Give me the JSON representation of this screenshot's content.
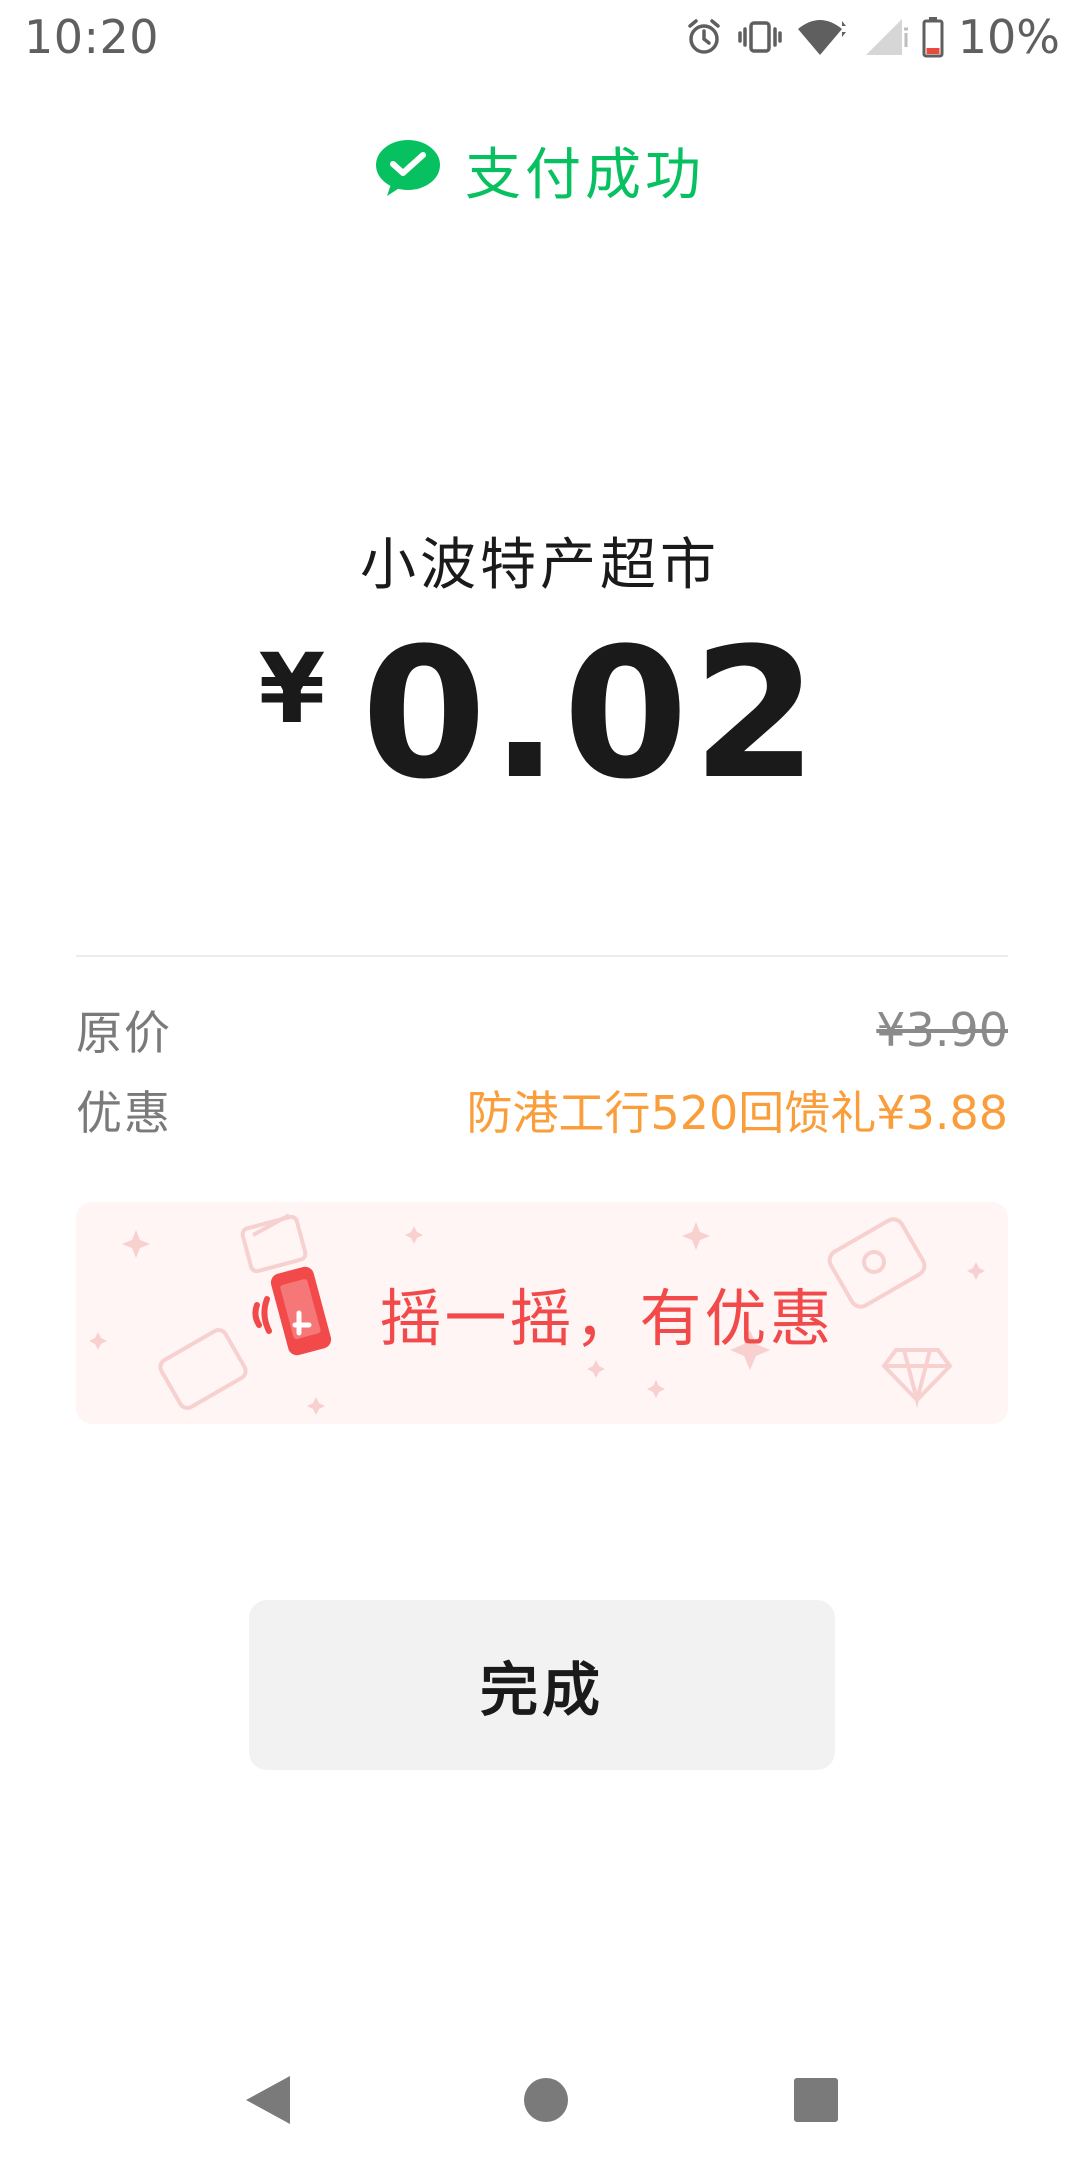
{
  "status_bar": {
    "time": "10:20",
    "battery": "10%",
    "icons": [
      "alarm-icon",
      "vibrate-icon",
      "wifi-icon",
      "signal-icon",
      "battery-icon"
    ]
  },
  "header": {
    "title": "支付成功",
    "icon": "wechat-pay-icon",
    "accent_color": "#07C160"
  },
  "merchant": "小波特产超市",
  "payment": {
    "currency_symbol": "¥",
    "amount": "0.02"
  },
  "details": [
    {
      "label": "原价",
      "value": "¥3.90",
      "style": "strikethrough"
    },
    {
      "label": "优惠",
      "value": "防港工行520回馈礼¥3.88",
      "style": "discount",
      "color": "#FA9D3B"
    }
  ],
  "promo_banner": {
    "text": "摇一摇，有优惠",
    "icon": "shake-phone-icon",
    "text_color": "#F24A4A"
  },
  "actions": {
    "done_label": "完成"
  },
  "nav_bar": [
    "back-icon",
    "home-icon",
    "recents-icon"
  ]
}
